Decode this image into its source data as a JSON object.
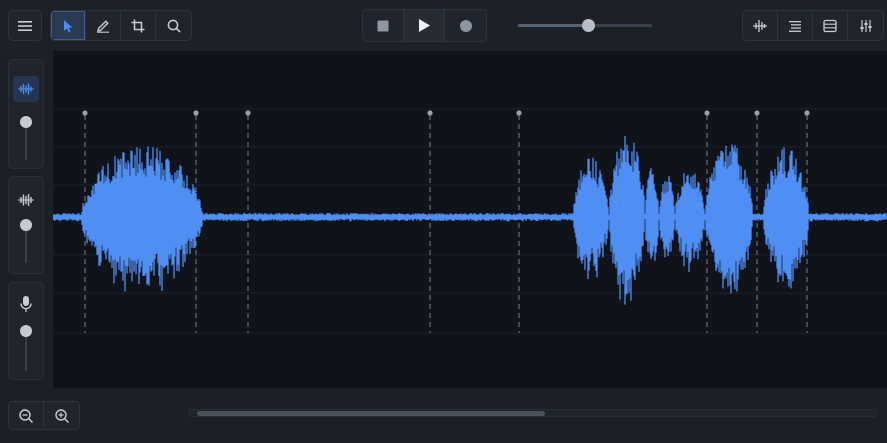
{
  "toolbar": {
    "menu_icon": "hamburger-menu-icon",
    "tools": [
      {
        "name": "pointer-tool",
        "icon": "cursor-arrow-icon",
        "active": true
      },
      {
        "name": "pencil-tool",
        "icon": "pencil-icon",
        "active": false
      },
      {
        "name": "crop-tool",
        "icon": "crop-icon",
        "active": false
      },
      {
        "name": "search-tool",
        "icon": "search-icon",
        "active": false
      }
    ],
    "transport": [
      {
        "name": "stop-button",
        "icon": "stop-icon"
      },
      {
        "name": "play-button",
        "icon": "play-icon"
      },
      {
        "name": "record-button",
        "icon": "record-icon"
      }
    ],
    "position_slider": {
      "value": 0.52
    },
    "view_buttons": [
      {
        "name": "waveform-view-button",
        "icon": "waveform-split-icon"
      },
      {
        "name": "list-view-button",
        "icon": "list-icon"
      },
      {
        "name": "tracks-view-button",
        "icon": "tracks-icon"
      },
      {
        "name": "mixer-button",
        "icon": "mixer-sliders-icon"
      }
    ]
  },
  "channels": [
    {
      "name": "waveform-channel",
      "icon": "waveform-icon",
      "active": true,
      "level": 0.0
    },
    {
      "name": "spectrum-channel",
      "icon": "spectrum-bars-icon",
      "active": false,
      "level": 0.0
    },
    {
      "name": "microphone-channel",
      "icon": "microphone-icon",
      "active": false,
      "level": 0.0
    }
  ],
  "colors": {
    "accent": "#4a8ff0",
    "waveform": "#4f8ef2",
    "marker": "#9aa1ac"
  },
  "zoom": [
    {
      "name": "zoom-out-button",
      "icon": "zoom-out-icon"
    },
    {
      "name": "zoom-in-button",
      "icon": "zoom-in-icon"
    }
  ],
  "scrollbar": {
    "start": 0.0,
    "visible_fraction": 0.5
  }
}
